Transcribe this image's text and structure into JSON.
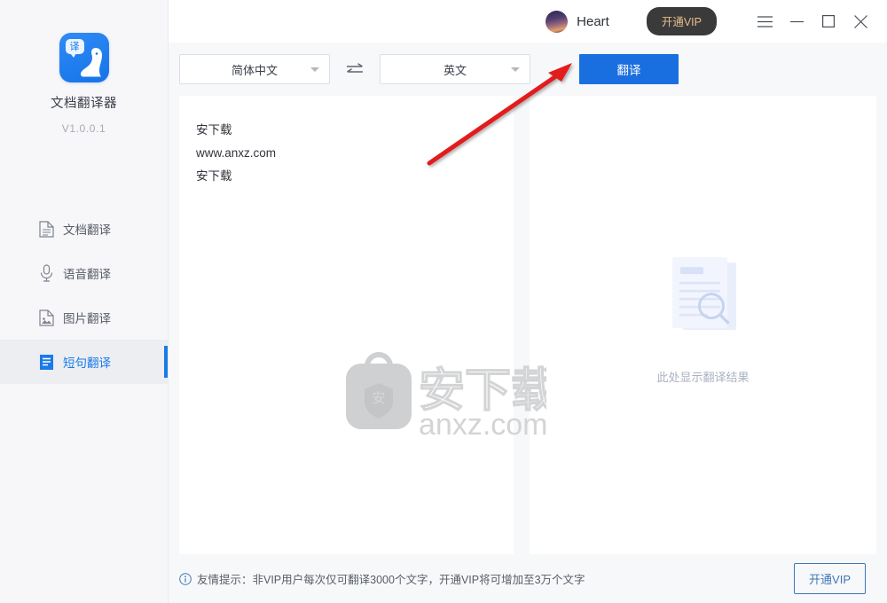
{
  "app": {
    "brand_name": "文档翻译器",
    "version": "V1.0.0.1",
    "logo_bubble_text": "译"
  },
  "sidebar": {
    "items": [
      {
        "label": "文档翻译",
        "icon": "document-icon",
        "active": false
      },
      {
        "label": "语音翻译",
        "icon": "microphone-icon",
        "active": false
      },
      {
        "label": "图片翻译",
        "icon": "image-icon",
        "active": false
      },
      {
        "label": "短句翻译",
        "icon": "text-lines-icon",
        "active": true
      }
    ]
  },
  "titlebar": {
    "username": "Heart",
    "vip_button": "开通VIP",
    "menu_icon": "hamburger-icon",
    "minimize_icon": "minimize-icon",
    "maximize_icon": "maximize-icon",
    "close_icon": "close-icon"
  },
  "toolbar": {
    "source_language": "简体中文",
    "target_language": "英文",
    "swap_icon": "swap-arrows-icon",
    "translate_button": "翻译"
  },
  "editor": {
    "source_lines": [
      "安下载",
      "www.anxz.com",
      "安下载"
    ],
    "result_placeholder": "此处显示翻译结果"
  },
  "watermark": {
    "text_cn": "安下载",
    "text_en": "anxz.com",
    "badge_char": "安"
  },
  "footer": {
    "tip_text": "友情提示：非VIP用户每次仅可翻译3000个文字，开通VIP将可增加至3万个文字",
    "info_icon": "info-circle-icon",
    "vip_button": "开通VIP"
  },
  "colors": {
    "accent_blue": "#1a6fe0",
    "sidebar_bg": "#f7f7fa",
    "active_blue": "#1a7ae8",
    "vip_gold": "#e7bf8c",
    "annotation_red": "#e21b1b"
  }
}
